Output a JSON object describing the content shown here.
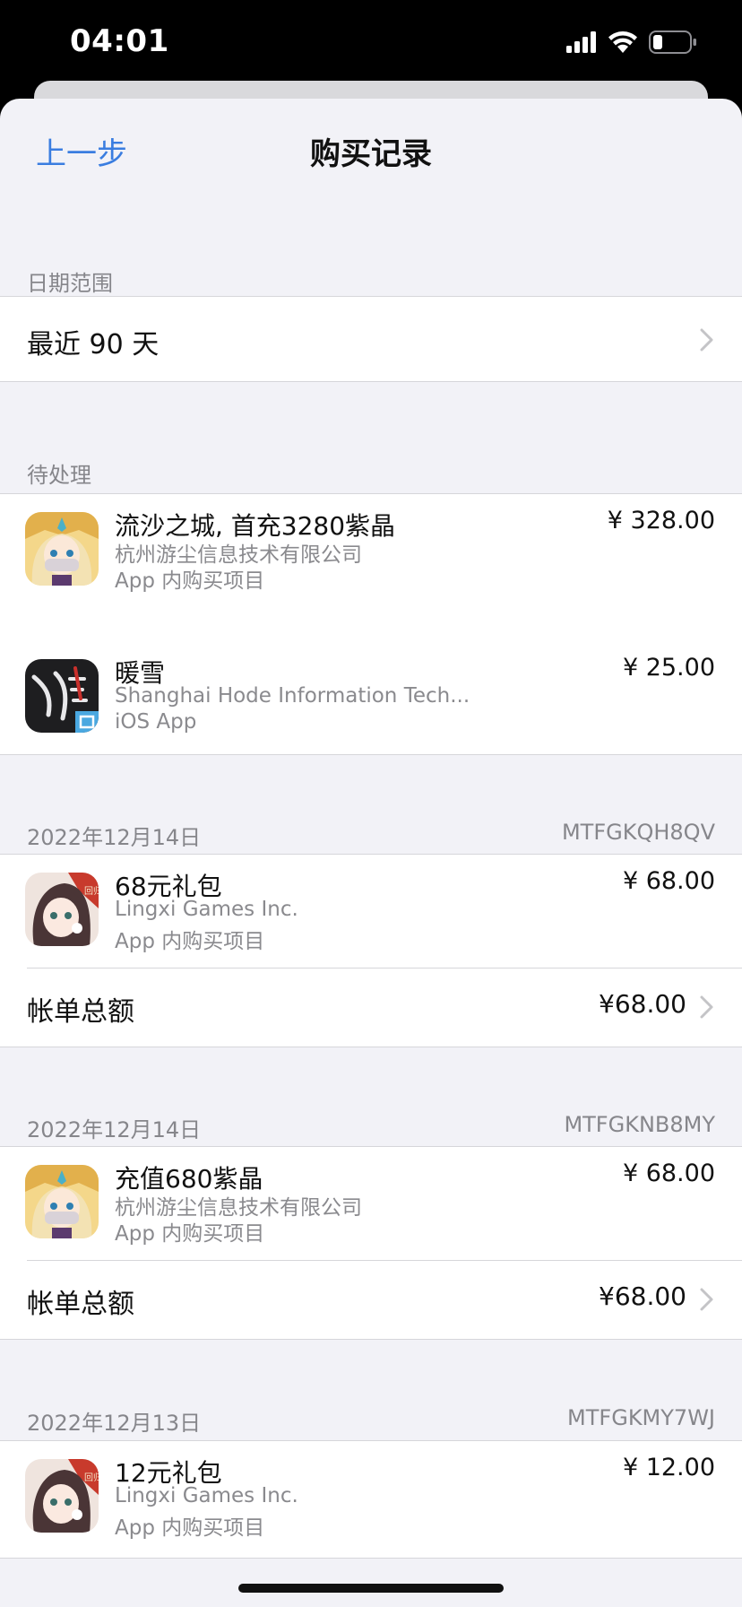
{
  "status": {
    "time": "04:01"
  },
  "nav": {
    "back": "上一步",
    "title": "购买记录"
  },
  "date_range": {
    "header": "日期范围",
    "value": "最近 90 天"
  },
  "pending": {
    "header": "待处理",
    "items": [
      {
        "title": "流沙之城, 首充3280紫晶",
        "developer": "杭州游尘信息技术有限公司",
        "type": "App 内购买项目",
        "price": "¥ 328.00",
        "icon": "heroine-game-icon"
      },
      {
        "title": "暖雪",
        "developer": "Shanghai Hode Information Tech...",
        "type": "iOS App",
        "price": "¥ 25.00",
        "icon": "nuanxue-game-icon"
      }
    ]
  },
  "orders": [
    {
      "date": "2022年12月14日",
      "order_id": "MTFGKQH8QV",
      "item": {
        "title": "68元礼包",
        "developer": "Lingxi Games Inc.",
        "type": "App 内购买项目",
        "price": "¥ 68.00",
        "icon": "lingxi-game-icon"
      },
      "total_label": "帐单总额",
      "total": "¥68.00"
    },
    {
      "date": "2022年12月14日",
      "order_id": "MTFGKNB8MY",
      "item": {
        "title": "充值680紫晶",
        "developer": "杭州游尘信息技术有限公司",
        "type": "App 内购买项目",
        "price": "¥ 68.00",
        "icon": "heroine-game-icon"
      },
      "total_label": "帐单总额",
      "total": "¥68.00"
    },
    {
      "date": "2022年12月13日",
      "order_id": "MTFGKMY7WJ",
      "item": {
        "title": "12元礼包",
        "developer": "Lingxi Games Inc.",
        "type": "App 内购买项目",
        "price": "¥ 12.00",
        "icon": "lingxi-game-icon"
      }
    }
  ],
  "colors": {
    "accent": "#3a7de0",
    "background": "#f2f2f7",
    "secondary_text": "#8a8a8e"
  }
}
